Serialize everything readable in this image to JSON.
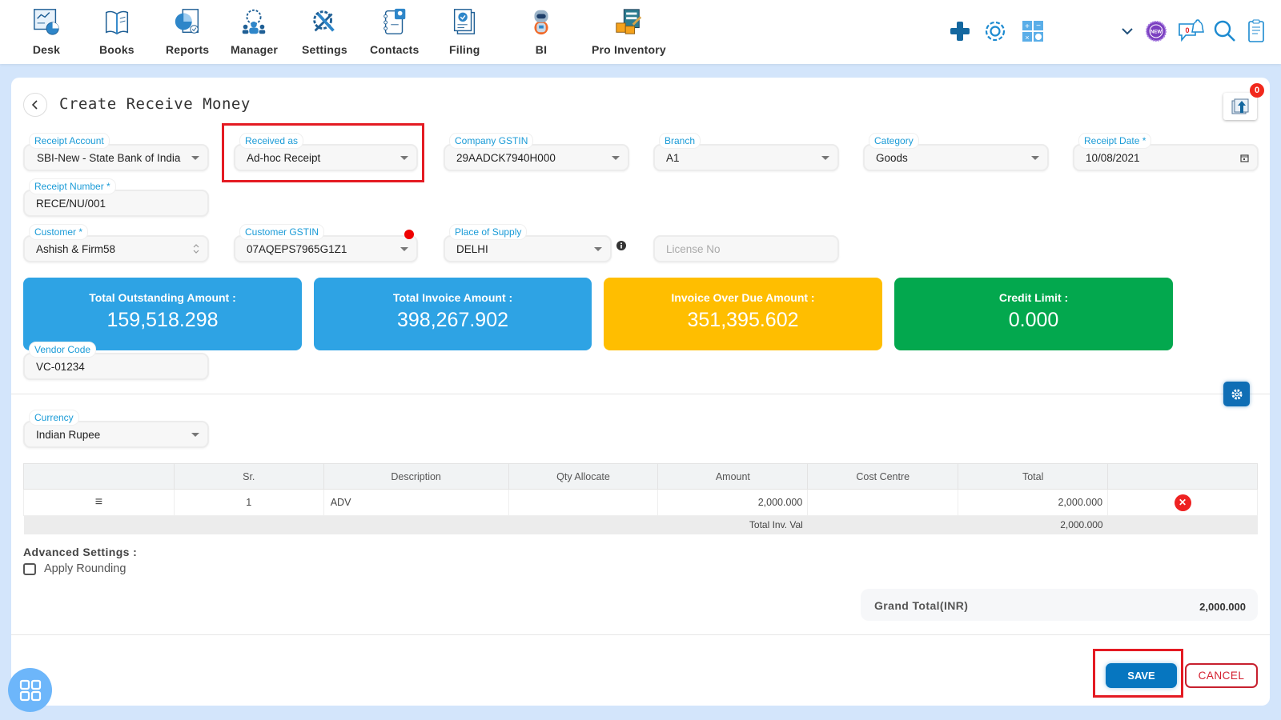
{
  "nav": {
    "items": [
      {
        "label": "Desk",
        "icon": "desk-icon"
      },
      {
        "label": "Books",
        "icon": "books-icon"
      },
      {
        "label": "Reports",
        "icon": "reports-icon"
      },
      {
        "label": "Manager",
        "icon": "manager-icon"
      },
      {
        "label": "Settings",
        "icon": "settings-icon"
      },
      {
        "label": "Contacts",
        "icon": "contacts-icon"
      },
      {
        "label": "Filing",
        "icon": "filing-icon"
      },
      {
        "label": "BI",
        "icon": "bi-robot-icon"
      },
      {
        "label": "Pro Inventory",
        "icon": "pro-inventory-icon"
      }
    ],
    "tools": [
      "plus-icon",
      "gear-icon",
      "calculator-icon",
      "chevron-down-icon",
      "new-badge-icon",
      "notification-icon",
      "search-icon",
      "notes-icon"
    ],
    "notification_count": "0",
    "new_badge_text": "NEW"
  },
  "page": {
    "title": "Create Receive Money",
    "attachment_count": "0"
  },
  "form": {
    "receipt_account": {
      "label": "Receipt Account",
      "value": "SBI-New - State Bank of India"
    },
    "received_as": {
      "label": "Received as",
      "value": "Ad-hoc Receipt"
    },
    "company_gstin": {
      "label": "Company GSTIN",
      "value": "29AADCK7940H000"
    },
    "branch": {
      "label": "Branch",
      "value": "A1"
    },
    "category": {
      "label": "Category",
      "value": "Goods"
    },
    "receipt_date": {
      "label": "Receipt Date *",
      "value": "10/08/2021"
    },
    "receipt_number": {
      "label": "Receipt Number *",
      "value": "RECE/NU/001"
    },
    "customer": {
      "label": "Customer *",
      "value": "Ashish & Firm58"
    },
    "customer_gstin": {
      "label": "Customer GSTIN",
      "value": "07AQEPS7965G1Z1"
    },
    "place_of_supply": {
      "label": "Place of Supply",
      "value": "DELHI"
    },
    "license_no": {
      "placeholder": "License No",
      "value": ""
    },
    "vendor_code": {
      "label": "Vendor Code",
      "value": "VC-01234"
    },
    "currency": {
      "label": "Currency",
      "value": "Indian Rupee"
    }
  },
  "stats": [
    {
      "label": "Total Outstanding Amount :",
      "value": "159,518.298",
      "color": "#2ea3e4"
    },
    {
      "label": "Total Invoice Amount :",
      "value": "398,267.902",
      "color": "#2ea3e4"
    },
    {
      "label": "Invoice Over Due Amount :",
      "value": "351,395.602",
      "color": "#ffbe00"
    },
    {
      "label": "Credit Limit :",
      "value": "0.000",
      "color": "#03a84e"
    }
  ],
  "table": {
    "headers": [
      "",
      "Sr.",
      "Description",
      "Qty Allocate",
      "Amount",
      "Cost Centre",
      "Total",
      ""
    ],
    "rows": [
      {
        "sr": "1",
        "description": "ADV",
        "qty": "",
        "amount": "2,000.000",
        "cost_centre": "",
        "total": "2,000.000"
      }
    ],
    "footer_label": "Total Inv. Val",
    "footer_value": "2,000.000"
  },
  "advanced": {
    "title": "Advanced Settings :",
    "apply_rounding": "Apply Rounding",
    "apply_rounding_checked": false
  },
  "grand_total": {
    "label": "Grand Total(INR)",
    "value": "2,000.000"
  },
  "actions": {
    "save": "SAVE",
    "cancel": "CANCEL"
  }
}
